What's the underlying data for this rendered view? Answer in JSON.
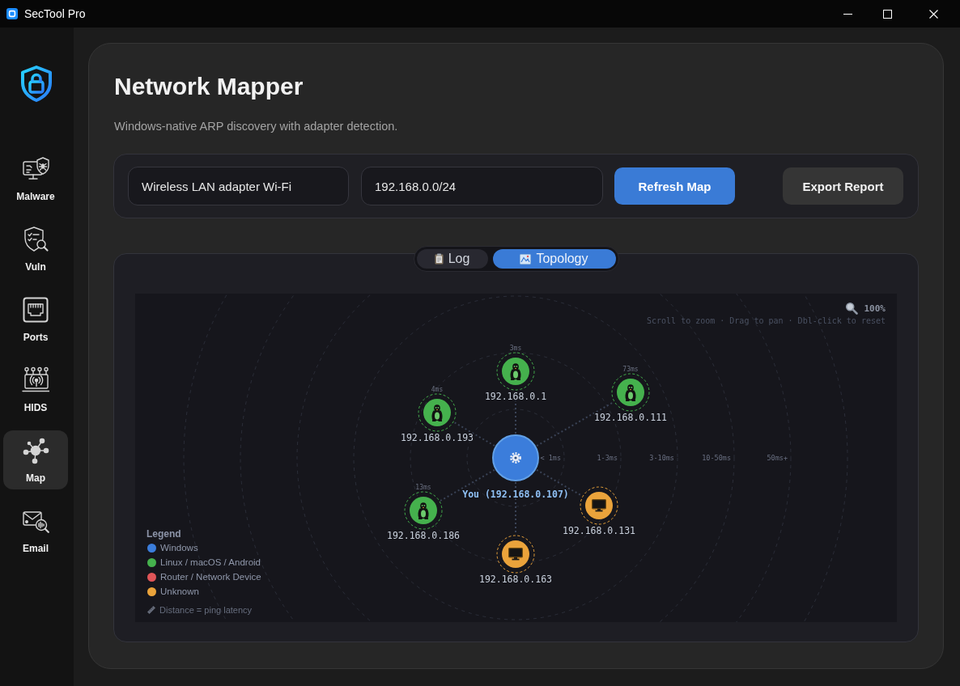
{
  "window": {
    "title": "SecTool Pro"
  },
  "sidebar": {
    "items": [
      {
        "label": "Malware",
        "selected": false
      },
      {
        "label": "Vuln",
        "selected": false
      },
      {
        "label": "Ports",
        "selected": false
      },
      {
        "label": "HIDS",
        "selected": false
      },
      {
        "label": "Map",
        "selected": true
      },
      {
        "label": "Email",
        "selected": false
      }
    ]
  },
  "header": {
    "title": "Network Mapper",
    "subtitle": "Windows-native ARP discovery with adapter detection."
  },
  "controls": {
    "adapter": {
      "value": "Wireless LAN adapter Wi-Fi"
    },
    "subnet": {
      "value": "192.168.0.0/24"
    },
    "buttons": [
      {
        "label": "Refresh Map",
        "kind": "primary"
      },
      {
        "label": "Export Report",
        "kind": "secondary"
      }
    ]
  },
  "view_tabs": [
    {
      "label": "Log",
      "selected": false
    },
    {
      "label": "Topology",
      "selected": true
    }
  ],
  "topology": {
    "zoom": "100%",
    "hint": "Scroll to zoom · Drag to pan · Dbl-click to reset",
    "rings": [
      "< 1ms",
      "1-3ms",
      "3-10ms",
      "10-50ms",
      "50ms+"
    ],
    "center": {
      "label": "You (192.168.0.107)",
      "kind": "windows"
    },
    "nodes": [
      {
        "ip": "192.168.0.1",
        "latency": "3ms",
        "kind": "linux"
      },
      {
        "ip": "192.168.0.111",
        "latency": "73ms",
        "kind": "linux"
      },
      {
        "ip": "192.168.0.193",
        "latency": "4ms",
        "kind": "linux"
      },
      {
        "ip": "192.168.0.131",
        "kind": "unknown"
      },
      {
        "ip": "192.168.0.186",
        "latency": "13ms",
        "kind": "linux"
      },
      {
        "ip": "192.168.0.163",
        "kind": "unknown"
      }
    ],
    "legend": {
      "title": "Legend",
      "items": [
        {
          "label": "Windows",
          "kind": "windows",
          "color": "#3b7ddb"
        },
        {
          "label": "Linux / macOS / Android",
          "kind": "linux",
          "color": "#45b14d"
        },
        {
          "label": "Router / Network Device",
          "kind": "router",
          "color": "#e05558"
        },
        {
          "label": "Unknown",
          "kind": "unknown",
          "color": "#eaa33b"
        }
      ],
      "note": "Distance = ping latency"
    }
  }
}
